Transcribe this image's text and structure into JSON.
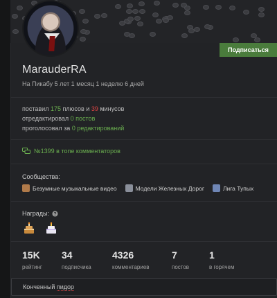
{
  "profile": {
    "username": "MarauderRA",
    "since": "На Пикабу 5 лет 1 месяц 1 неделю 6 дней",
    "subscribe_label": "Подписаться"
  },
  "activity": {
    "line1_prefix": "поставил",
    "plus_count": "175",
    "plus_word": "плюсов",
    "and_word": "и",
    "minus_count": "39",
    "minus_word": "минусов",
    "line2_prefix": "отредактировал",
    "edited": "0 постов",
    "line3_prefix": "проголосовал за",
    "voted": "0 редактирований"
  },
  "rank": {
    "text": "№1399 в топе комментаторов",
    "icon": "comments-icon"
  },
  "communities": {
    "title": "Сообщества:",
    "items": [
      {
        "label": "Безумные музыкальные видео",
        "color": "#b07a4a"
      },
      {
        "label": "Модели Железных Дорог",
        "color": "#8a8f9a"
      },
      {
        "label": "Лига Тупых",
        "color": "#6f86b5"
      }
    ]
  },
  "awards": {
    "title": "Награды:",
    "help_icon": "question-icon",
    "items": [
      "cake-award-icon",
      "cake-award-icon"
    ]
  },
  "stats": [
    {
      "value": "15K",
      "label": "рейтинг"
    },
    {
      "value": "34",
      "label": "подписчика"
    },
    {
      "value": "4326",
      "label": "комментариев"
    },
    {
      "value": "7",
      "label": "постов"
    },
    {
      "value": "1",
      "label": "в горячем"
    }
  ],
  "note": {
    "text_a": "Конченный ",
    "text_b": "пидор"
  },
  "colors": {
    "accent_green": "#6aae4f",
    "minus_red": "#e04444",
    "subscribe_bg": "#4a7c3c"
  }
}
